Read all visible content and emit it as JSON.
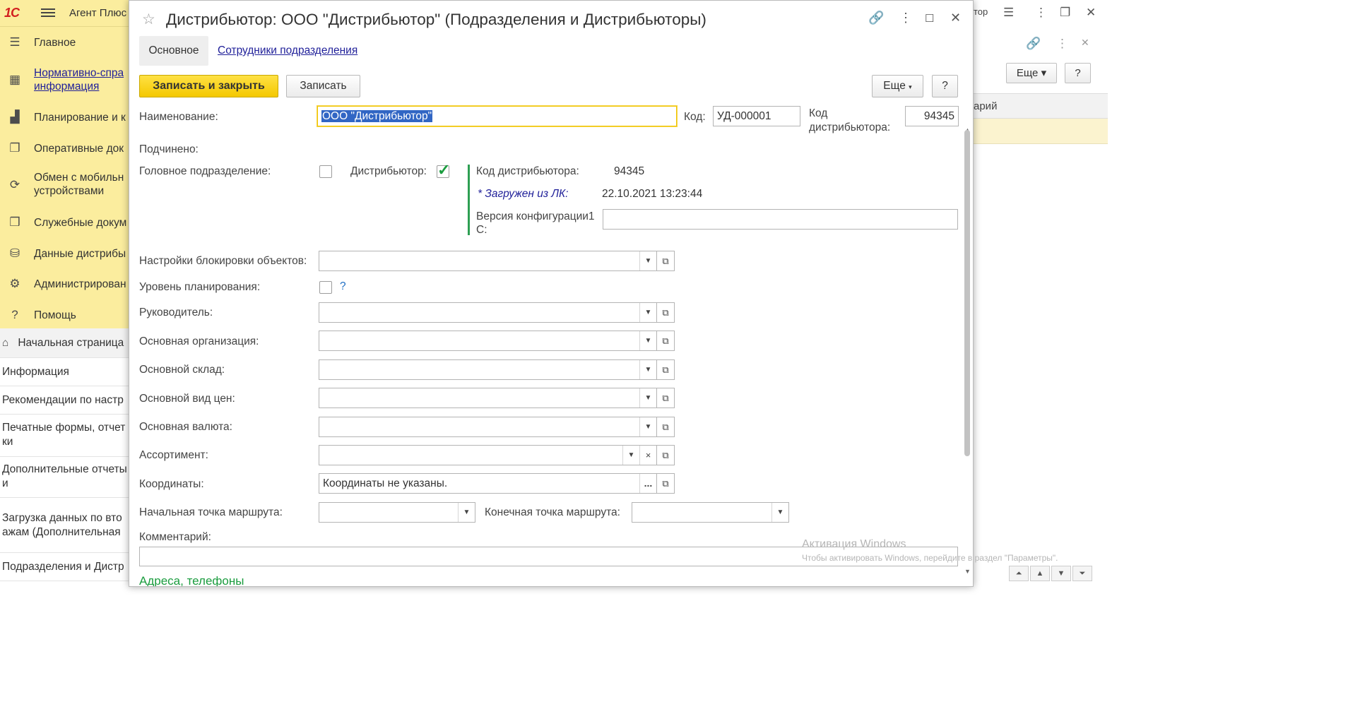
{
  "app": {
    "logo": "1С",
    "title": "Агент Плюс",
    "sidebar": [
      {
        "icon": "menu-lines-icon",
        "label": "Главное",
        "link": false
      },
      {
        "icon": "grid-icon",
        "label": "Нормативно-справочная информация",
        "line1": "Нормативно-спра",
        "line2": "информация",
        "link": true
      },
      {
        "icon": "bar-chart-icon",
        "label": "Планирование и к",
        "link": false
      },
      {
        "icon": "documents-icon",
        "label": "Оперативные док",
        "link": false
      },
      {
        "icon": "sync-icon",
        "label": "Обмен с мобильными устройствами",
        "line1": "Обмен с мобильн",
        "line2": "устройствами",
        "link": false
      },
      {
        "icon": "service-docs-icon",
        "label": "Служебные докум",
        "link": false
      },
      {
        "icon": "distributor-data-icon",
        "label": "Данные дистрибы",
        "link": false
      },
      {
        "icon": "gear-icon",
        "label": "Администрирован",
        "link": false
      },
      {
        "icon": "help-icon",
        "label": "Помощь",
        "link": false
      }
    ],
    "subnav": [
      {
        "label": "Начальная страница"
      },
      {
        "label": "Информация"
      },
      {
        "label": "Рекомендации по настр"
      },
      {
        "line1": "Печатные формы, отчет",
        "line2": "ки"
      },
      {
        "line1": "Дополнительные отчеты",
        "line2": "и"
      },
      {
        "line1": "Загрузка данных по вто",
        "line2": "ажам (Дополнительная"
      },
      {
        "label": "Подразделения и Дистр"
      }
    ]
  },
  "bg_window": {
    "title_fragment": "тор",
    "more_label": "Еще",
    "help_label": "?",
    "column_fragment": "арий"
  },
  "form": {
    "title": "Дистрибьютор: ООО \"Дистрибьютор\" (Подразделения и Дистрибьюторы)",
    "tabs": {
      "main": "Основное",
      "employees": "Сотрудники подразделения"
    },
    "buttons": {
      "save_close": "Записать и закрыть",
      "save": "Записать",
      "more": "Еще",
      "help": "?"
    },
    "name": {
      "label": "Наименование:",
      "value": "ООО \"Дистрибьютор\""
    },
    "code": {
      "label": "Код:",
      "value": "УД-000001"
    },
    "dist_code": {
      "label_line1": "Код",
      "label_line2": "дистрибьютора:",
      "value": "94345"
    },
    "subordinate": {
      "label": "Подчинено:"
    },
    "head_division": {
      "label": "Головное подразделение:",
      "checked": false
    },
    "distributor": {
      "label": "Дистрибьютор:",
      "checked": true
    },
    "dist_info": {
      "code_label": "Код дистрибьютора:",
      "code_value": "94345",
      "loaded_label": "* Загружен из ЛК:",
      "loaded_value": "22.10.2021 13:23:44",
      "config_label_line1": "Версия конфигурации1",
      "config_label_line2": "С:",
      "config_value": ""
    },
    "lock_settings": {
      "label": "Настройки блокировки объектов:",
      "value": ""
    },
    "plan_level": {
      "label": "Уровень планирования:",
      "checked": false,
      "help": "?"
    },
    "manager": {
      "label": "Руководитель:",
      "value": ""
    },
    "organization": {
      "label": "Основная организация:",
      "value": ""
    },
    "warehouse": {
      "label": "Основной склад:",
      "value": ""
    },
    "price_type": {
      "label": "Основной вид цен:",
      "value": ""
    },
    "currency": {
      "label": "Основная валюта:",
      "value": ""
    },
    "assortment": {
      "label": "Ассортимент:",
      "value": ""
    },
    "coordinates": {
      "label": "Координаты:",
      "value": "Координаты не указаны.",
      "button": "..."
    },
    "route_start": {
      "label": "Начальная точка маршрута:",
      "value": ""
    },
    "route_end": {
      "label": "Конечная точка маршрута:",
      "value": ""
    },
    "comment": {
      "label": "Комментарий:",
      "value": ""
    },
    "next_section": "Адреса, телефоны"
  },
  "watermark": {
    "line1": "Активация Windows",
    "line2": "Чтобы активировать Windows, перейдите в раздел \"Параметры\"."
  },
  "colors": {
    "accent_yellow": "#f4c800",
    "panel_yellow": "#fbed9e",
    "link_blue": "#1f1f99",
    "check_green": "#1a9c3e"
  }
}
